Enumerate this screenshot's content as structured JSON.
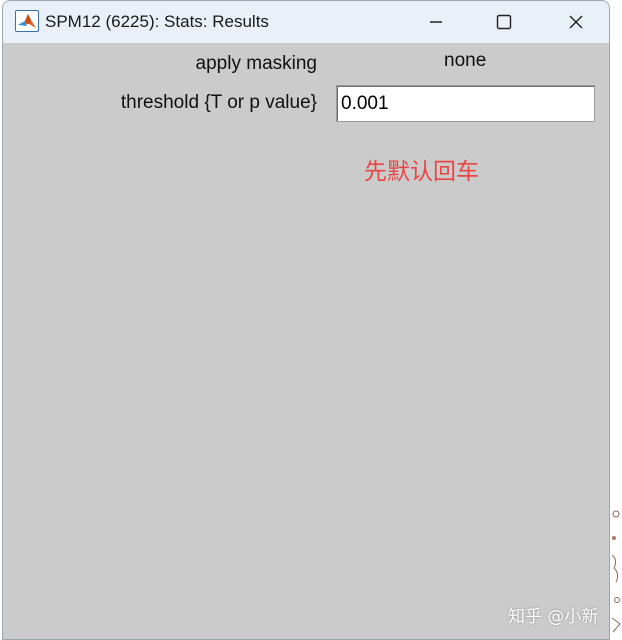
{
  "window": {
    "title": "SPM12 (6225): Stats: Results"
  },
  "form": {
    "masking_label": "apply masking",
    "masking_value": "none",
    "threshold_label": "threshold {T or p value}",
    "threshold_value": "0.001"
  },
  "annotation": {
    "text": "先默认回车",
    "color": "#e84545"
  },
  "watermark": {
    "text": "知乎 @小新"
  },
  "icons": {
    "app": "matlab-logo-icon",
    "minimize": "minimize-icon",
    "maximize": "maximize-icon",
    "close": "close-icon"
  },
  "colors": {
    "titlebar": "#e9f0f7",
    "panel": "#cbcbcb"
  }
}
